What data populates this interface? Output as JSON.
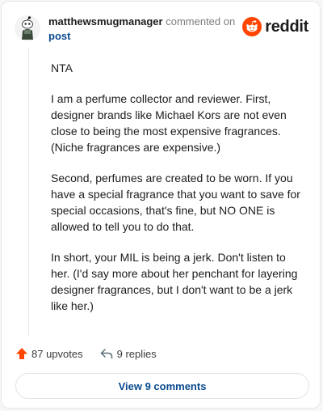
{
  "header": {
    "username": "matthewsmugmanager",
    "action": "commented on",
    "link": "post"
  },
  "brand": {
    "wordmark": "reddit",
    "color": "#ff4500"
  },
  "comment": {
    "paragraphs": [
      "NTA",
      "I am a perfume collector and reviewer. First, designer brands like Michael Kors are not even close to being the most expensive fragrances. (Niche fragrances are expensive.)",
      "Second, perfumes are created to be worn. If you have a special fragrance that you want to save for special occasions, that's fine, but NO ONE is allowed to tell you to do that.",
      "In short, your MIL is being a jerk. Don't listen to her. (I'd say more about her penchant for layering designer fragrances, but I don't want to be a jerk like her.)"
    ]
  },
  "footer": {
    "upvotes": "87 upvotes",
    "replies": "9 replies",
    "upvote_icon": "upvote-arrow-icon",
    "reply_icon": "reply-arrow-icon"
  },
  "view_comments": "View 9 comments"
}
